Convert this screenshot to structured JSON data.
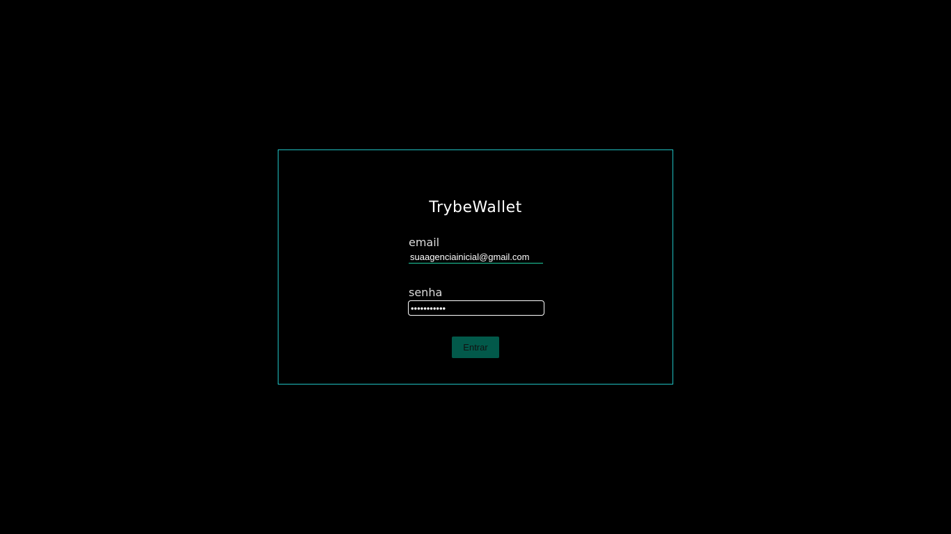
{
  "app": {
    "title": "TrybeWallet"
  },
  "form": {
    "email_label": "email",
    "email_value": "suaagenciainicial@gmail.com",
    "password_label": "senha",
    "password_value": "•••••••••••",
    "submit_label": "Entrar"
  },
  "colors": {
    "background": "#000000",
    "card_border": "#1fc1c4",
    "email_underline": "#1fd1a4",
    "button_bg": "#02594a"
  }
}
